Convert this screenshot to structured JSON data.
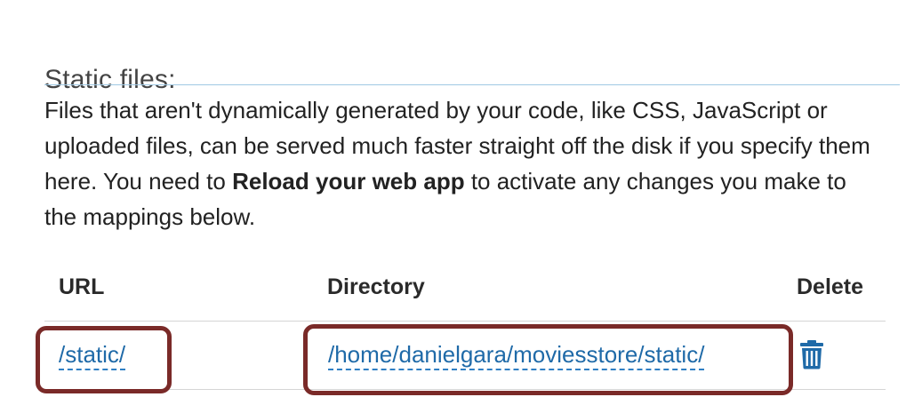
{
  "static_files": {
    "title": "Static files:",
    "description": {
      "before": "Files that aren't dynamically generated by your code, like CSS, JavaScript or uploaded files, can be served much faster straight off the disk if you specify them here. You need to ",
      "bold": "Reload your web app",
      "after": " to activate any changes you make to the mappings below."
    },
    "table": {
      "headers": {
        "url": "URL",
        "directory": "Directory",
        "delete": "Delete"
      },
      "rows": [
        {
          "url": "/static/",
          "directory": "/home/danielgara/moviesstore/static/",
          "delete_icon": "trash-icon"
        }
      ]
    }
  },
  "colors": {
    "link": "#1f6aa8",
    "title_rule": "#9fc9e4",
    "highlight_border": "#7a2a28"
  }
}
